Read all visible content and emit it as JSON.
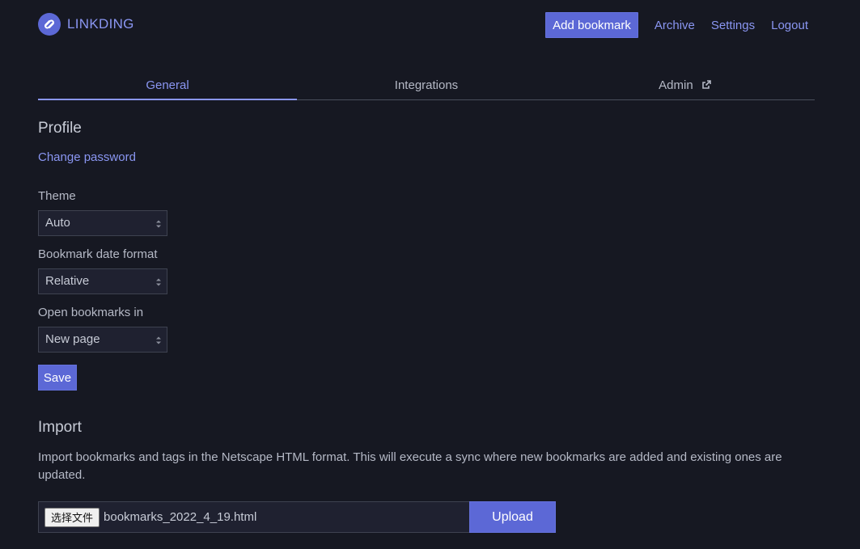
{
  "header": {
    "brand": "LINKDING",
    "add_bookmark": "Add bookmark",
    "nav": [
      "Archive",
      "Settings",
      "Logout"
    ]
  },
  "tabs": [
    {
      "label": "General",
      "active": true
    },
    {
      "label": "Integrations",
      "active": false
    },
    {
      "label": "Admin",
      "active": false
    }
  ],
  "profile": {
    "heading": "Profile",
    "change_password": "Change password",
    "theme_label": "Theme",
    "theme_value": "Auto",
    "date_format_label": "Bookmark date format",
    "date_format_value": "Relative",
    "open_in_label": "Open bookmarks in",
    "open_in_value": "New page",
    "save": "Save"
  },
  "import": {
    "heading": "Import",
    "description": "Import bookmarks and tags in the Netscape HTML format. This will execute a sync where new bookmarks are added and existing ones are updated.",
    "choose_file": "选择文件",
    "file_name": "bookmarks_2022_4_19.html",
    "upload": "Upload"
  },
  "colors": {
    "background": "#161822",
    "accent": "#5c68d6",
    "link": "#8a96f2"
  }
}
